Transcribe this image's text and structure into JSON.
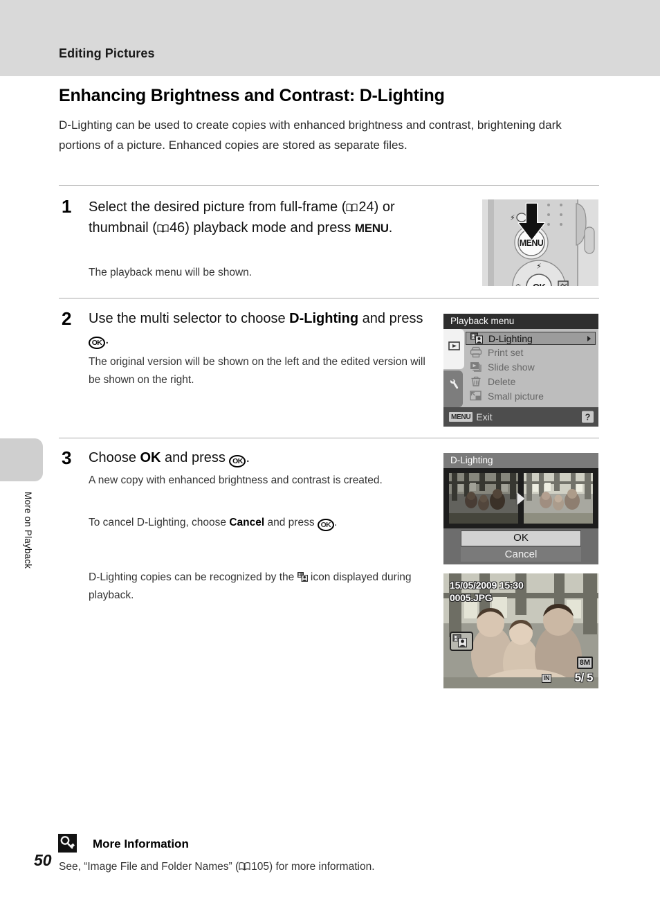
{
  "header": {
    "chapter_title": "Editing Pictures"
  },
  "sidebar": {
    "vertical_label": "More on Playback"
  },
  "page": {
    "number": "50",
    "section_title": "Enhancing Brightness and Contrast: D-Lighting",
    "intro": "D-Lighting can be used to create copies with enhanced brightness and contrast, brightening dark portions of a picture. Enhanced copies are stored as separate files."
  },
  "steps": [
    {
      "number": "1",
      "head_part1": "Select the desired picture from full-frame (",
      "ref1": "24",
      "head_part2": ") or thumbnail (",
      "ref2": "46",
      "head_part3": ") playback mode and press ",
      "menu_glyph": "MENU",
      "head_end": ".",
      "body": "The playback menu will be shown."
    },
    {
      "number": "2",
      "head_part1": "Use the multi selector to choose ",
      "head_bold": "D-Lighting",
      "head_part2": " and press ",
      "ok_glyph": "OK",
      "head_end": ".",
      "body": "The original version will be shown on the left and the edited version will be shown on the right."
    },
    {
      "number": "3",
      "head_part1": "Choose ",
      "head_bold": "OK",
      "head_part2": " and press ",
      "ok_glyph": "OK",
      "head_end": ".",
      "body1": "A new copy with enhanced brightness and contrast is created.",
      "body2_part1": "To cancel D-Lighting, choose ",
      "body2_bold": "Cancel",
      "body2_part2": " and press ",
      "body2_end": ".",
      "body3_part1": "D-Lighting copies can be recognized by the ",
      "body3_part2": " icon displayed during playback."
    }
  ],
  "camera_figure": {
    "button_label": "MENU",
    "flash_label": "⚡",
    "multi_ok_label": "OK"
  },
  "playback_menu_screen": {
    "title": "Playback menu",
    "items": [
      {
        "label": "D-Lighting",
        "icon": "d-lighting-icon",
        "selected": true,
        "has_submenu": true
      },
      {
        "label": "Print set",
        "icon": "printer-icon",
        "selected": false,
        "has_submenu": false
      },
      {
        "label": "Slide show",
        "icon": "slideshow-icon",
        "selected": false,
        "has_submenu": false
      },
      {
        "label": "Delete",
        "icon": "trash-icon",
        "selected": false,
        "has_submenu": false
      },
      {
        "label": "Small picture",
        "icon": "small-picture-icon",
        "selected": false,
        "has_submenu": false
      }
    ],
    "tabs": [
      "playback-tab-icon",
      "setup-tab-icon"
    ],
    "footer": {
      "menu_badge": "MENU",
      "exit_label": "Exit",
      "help_badge": "?"
    }
  },
  "dlighting_screen": {
    "title": "D-Lighting",
    "ok_label": "OK",
    "cancel_label": "Cancel",
    "selected_button": "OK"
  },
  "playback_image_screen": {
    "date": "15/05/2009 15:30",
    "filename": "0005.JPG",
    "dlighting_badge": "d-lighting-copy-icon",
    "resolution_badge": "8M",
    "internal_memory_badge": "IN",
    "frame_counter": "5/  5"
  },
  "more_information": {
    "icon": "key-icon",
    "title": "More Information",
    "text_part1": "See, “Image File and Folder Names” (",
    "ref": "105",
    "text_part2": ") for more information."
  },
  "colors": {
    "header_band": "#d9d9d9",
    "rule": "#aaaaaa",
    "lcd_bg": "#585858",
    "lcd_title_bar": "#2e2e2e",
    "menu_body": "#bdbdbd",
    "menu_selected": "#9c9c9c"
  }
}
